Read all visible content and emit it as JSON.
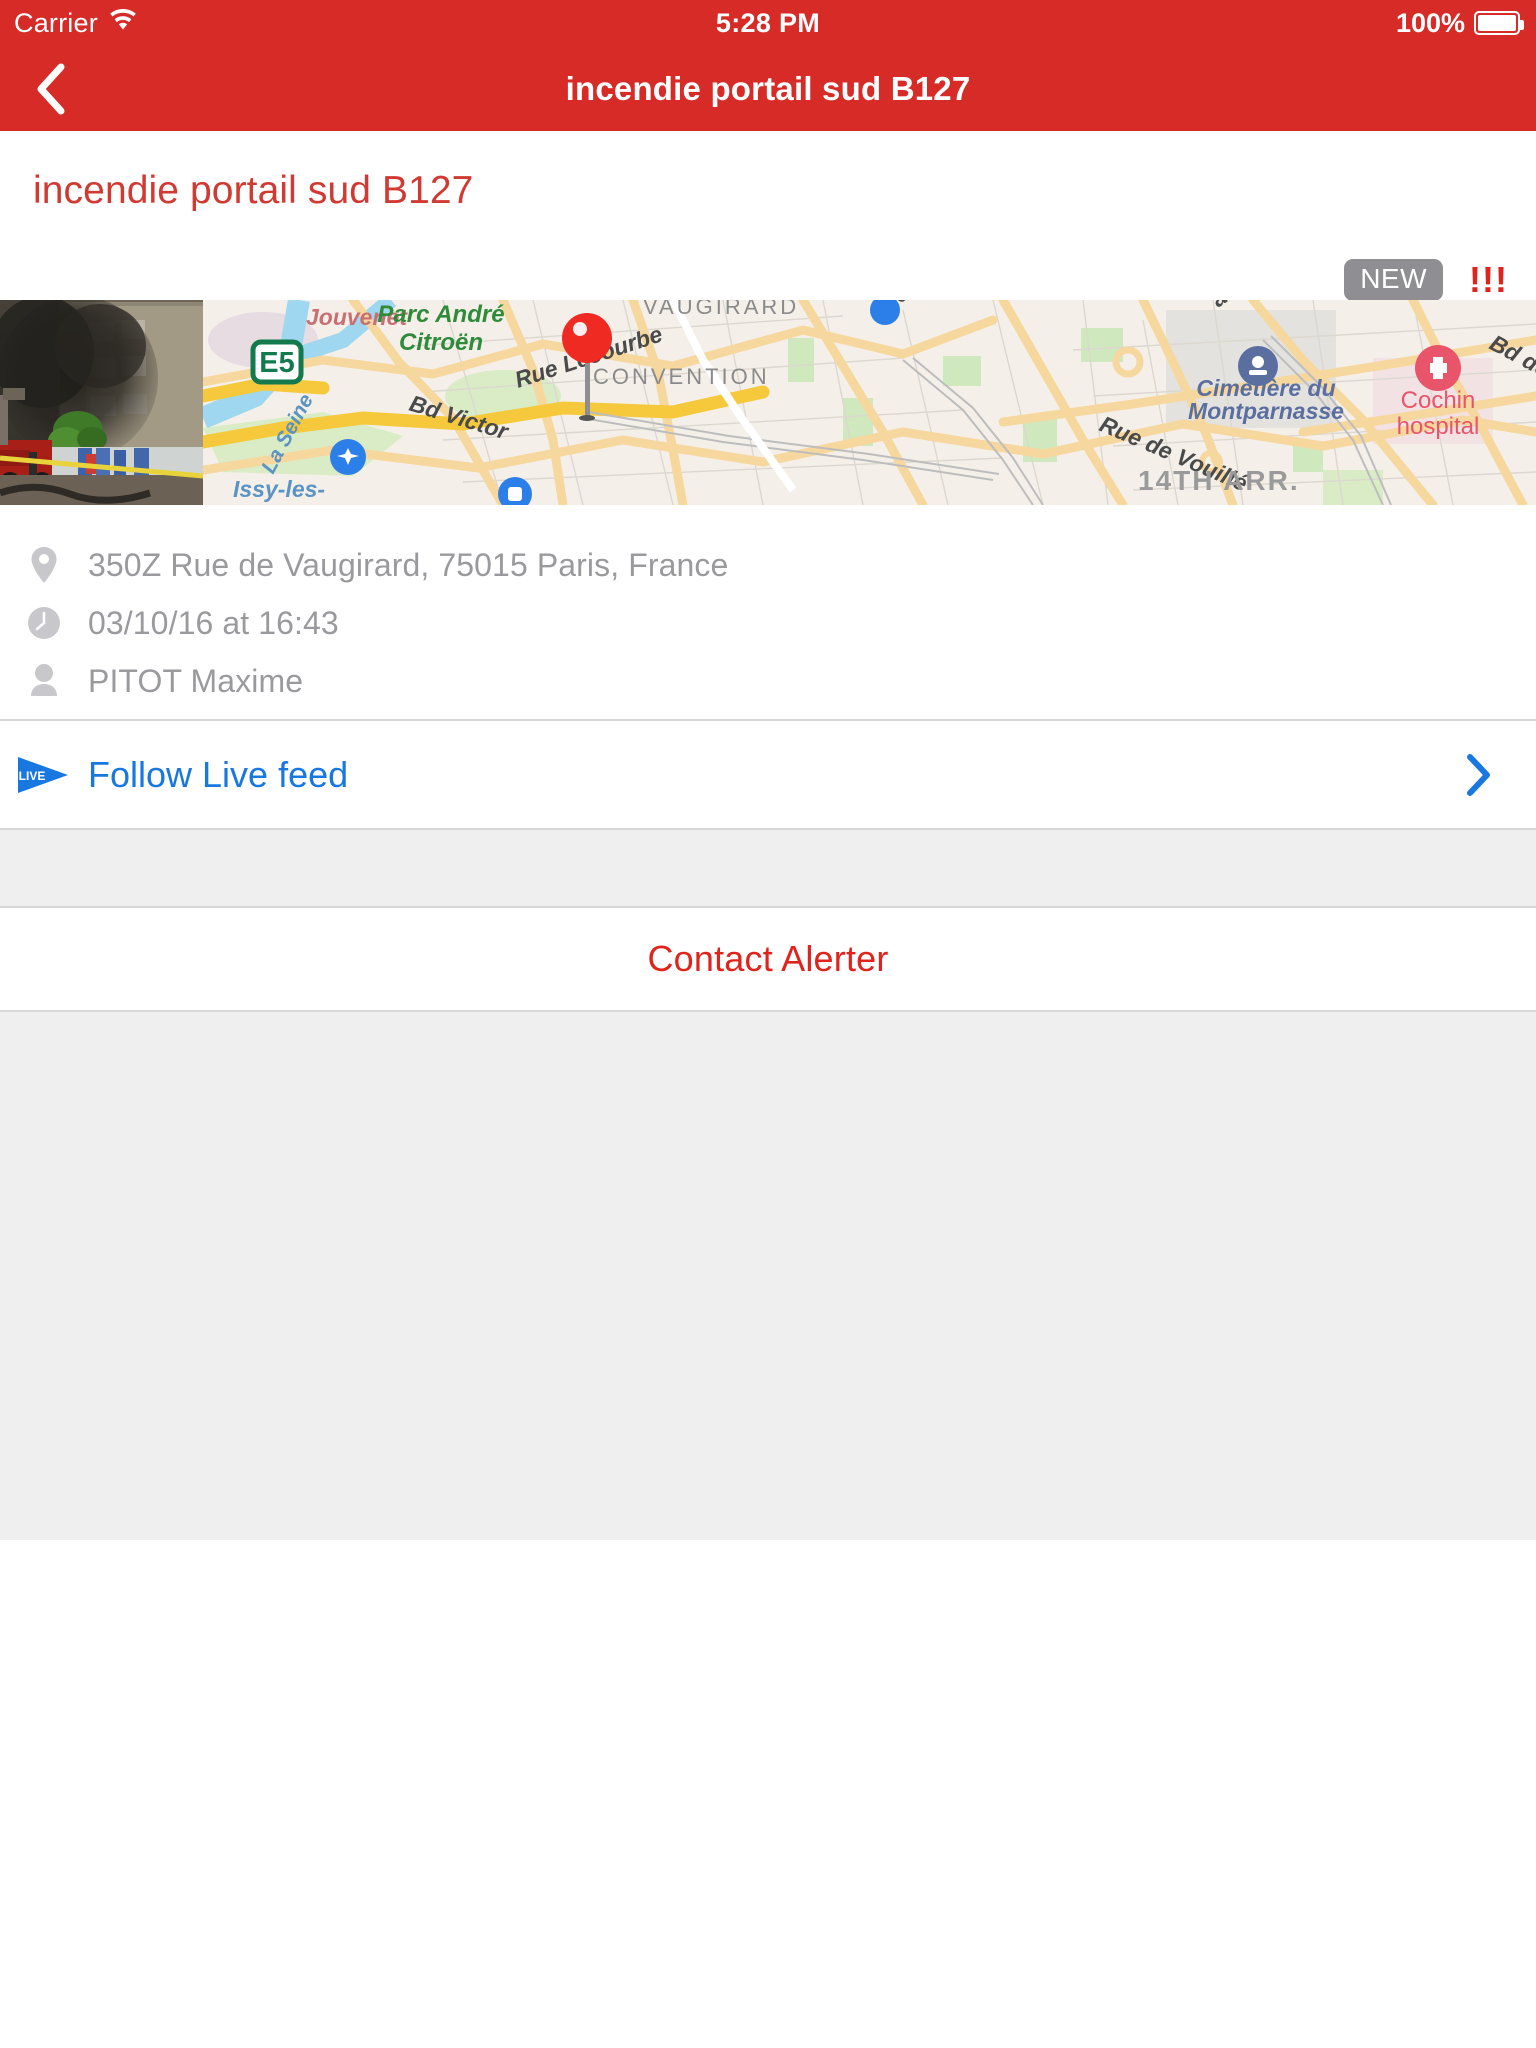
{
  "status_bar": {
    "carrier": "Carrier",
    "wifi_icon": "wifi-icon",
    "time": "5:28 PM",
    "battery_percent": "100%",
    "battery_icon": "battery-full-icon"
  },
  "nav_bar": {
    "back_icon": "chevron-left-icon",
    "title": "incendie portail sud B127",
    "background_color": "#D62B27"
  },
  "alert": {
    "title": "incendie portail sud B127",
    "title_color": "#D03A33",
    "new_badge": "NEW",
    "new_badge_color": "#8E8E93",
    "priority_marks": "!!!",
    "priority_color": "#E0231C"
  },
  "media": {
    "photo_name": "incident-photo-fire-smoke",
    "map_name": "incident-location-map",
    "map_pin": "map-pin-red",
    "map_labels": [
      "Jouvenet",
      "Parc André Citroën",
      "La Seine",
      "E5",
      "Bd Victor",
      "Rue Lecourbe",
      "CONVENTION",
      "VAUGIRARD",
      "Rue de Vouillé",
      "Issy-les-",
      "Cimetière du Montparnasse",
      "Cochin hospital",
      "14TH ARR.",
      "Bd de Por"
    ]
  },
  "info": {
    "rows": [
      {
        "icon": "map-pin-icon",
        "text": "350Z Rue de Vaugirard, 75015 Paris, France"
      },
      {
        "icon": "clock-icon",
        "text": "03/10/16 at 16:43"
      },
      {
        "icon": "person-icon",
        "text": "PITOT Maxime"
      }
    ]
  },
  "live_feed": {
    "icon": "live-play-icon",
    "icon_text": "LIVE",
    "label": "Follow Live feed",
    "label_color": "#1878E0",
    "chevron": "chevron-right-icon"
  },
  "contact": {
    "label": "Contact Alerter",
    "label_color": "#E0231C"
  }
}
